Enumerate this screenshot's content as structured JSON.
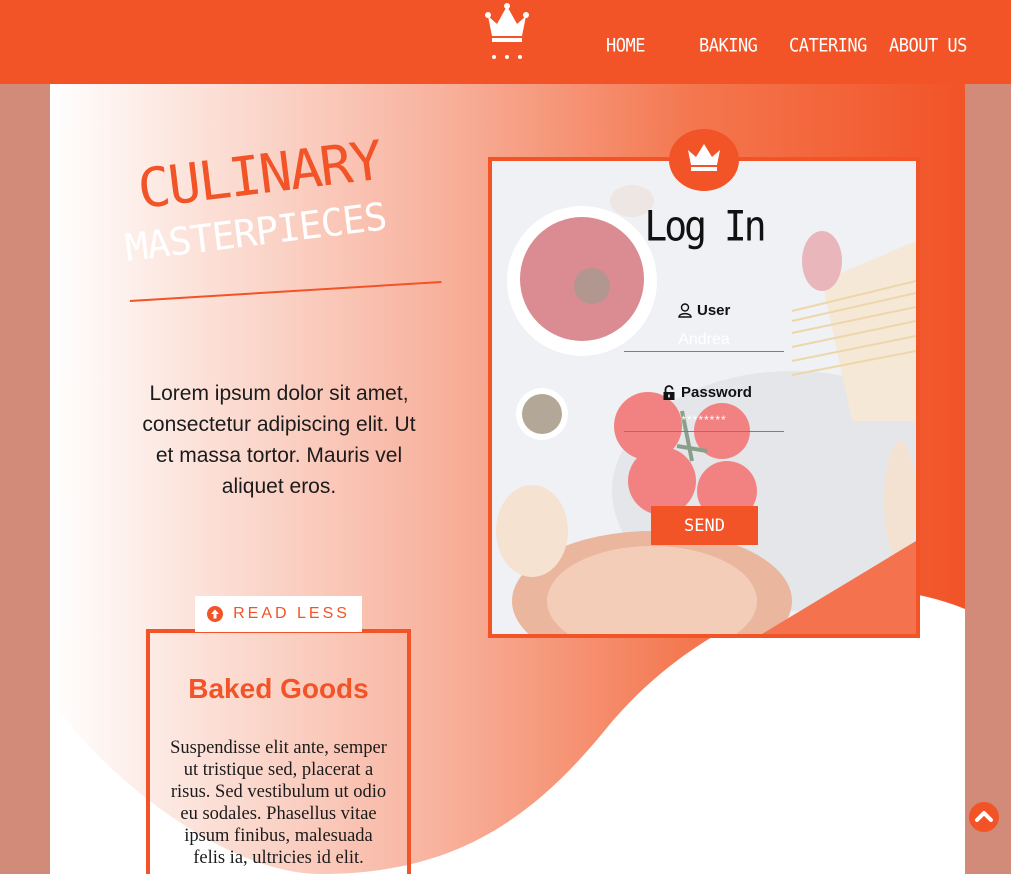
{
  "header": {
    "logo_icon": "crown-icon",
    "nav": [
      {
        "label": "HOME"
      },
      {
        "label": "BAKING"
      },
      {
        "label": "CATERING"
      },
      {
        "label": "ABOUT US"
      }
    ]
  },
  "hero": {
    "title_line1": "CULINARY",
    "title_line2": "MASTERPIECES",
    "body": "Lorem ipsum dolor sit amet, consectetur adipiscing elit. Ut et massa tortor. Mauris vel aliquet eros."
  },
  "read_less": {
    "label": "READ LESS",
    "icon": "arrow-up-circle-icon"
  },
  "card": {
    "title": "Baked Goods",
    "text": "Suspendisse elit ante, semper ut tristique sed, placerat a risus. Sed vestibulum ut odio eu sodales. Phasellus vitae ipsum finibus, malesuada felis ia, ultricies id elit."
  },
  "login": {
    "title": "Log In",
    "user_label": "User",
    "user_placeholder": "Andrea",
    "password_label": "Password",
    "password_value": "********",
    "send_label": "SEND"
  },
  "colors": {
    "accent": "#f25327",
    "side": "#d28b79",
    "white": "#ffffff"
  }
}
